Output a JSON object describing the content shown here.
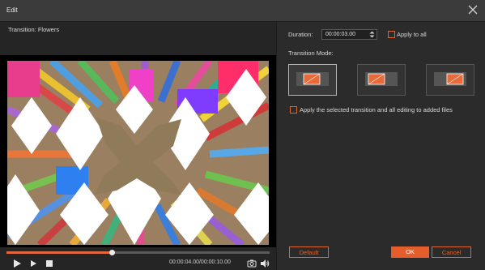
{
  "window": {
    "title": "Edit"
  },
  "preview": {
    "transition_label": "Transition: Flowers",
    "time_display": "00:00:04.00/00:00:10.00",
    "progress": 0.4
  },
  "settings": {
    "duration_label": "Duration:",
    "duration_value": "00:00:03.00",
    "apply_to_all_label": "Apply to all",
    "transition_mode_label": "Transition Mode:",
    "apply_selected_label": "Apply the selected transition and all editing to added files"
  },
  "buttons": {
    "default": "Default",
    "ok": "OK",
    "cancel": "Cancel"
  },
  "colors": {
    "accent": "#e0662f",
    "background": "#2b2b2b",
    "panel": "#252525"
  }
}
